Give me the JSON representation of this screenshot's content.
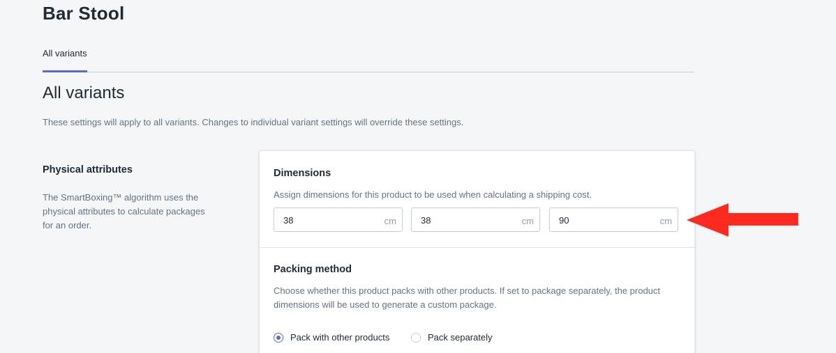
{
  "product": {
    "title": "Bar Stool"
  },
  "tabs": [
    {
      "label": "All variants",
      "selected": true
    }
  ],
  "section": {
    "heading": "All variants",
    "description": "These settings will apply to all variants. Changes to individual variant settings will override these settings."
  },
  "physical_attributes": {
    "title": "Physical attributes",
    "description": "The SmartBoxing™ algorithm uses the physical attributes to calculate packages for an order."
  },
  "dimensions": {
    "title": "Dimensions",
    "description": "Assign dimensions for this product to be used when calculating a shipping cost.",
    "fields": [
      {
        "value": "38",
        "unit": "cm"
      },
      {
        "value": "38",
        "unit": "cm"
      },
      {
        "value": "90",
        "unit": "cm"
      }
    ]
  },
  "packing_method": {
    "title": "Packing method",
    "description": "Choose whether this product packs with other products. If set to package separately, the product dimensions will be used to generate a custom package.",
    "options": [
      {
        "label": "Pack with other products",
        "selected": true
      },
      {
        "label": "Pack separately",
        "selected": false
      }
    ]
  },
  "colors": {
    "accent": "#5c6ac4",
    "annotation_arrow": "#ff2a1f",
    "background": "#f4f6f8"
  },
  "icons": [
    "radio-selected-icon",
    "radio-unselected-icon",
    "annotation-arrow-icon"
  ]
}
